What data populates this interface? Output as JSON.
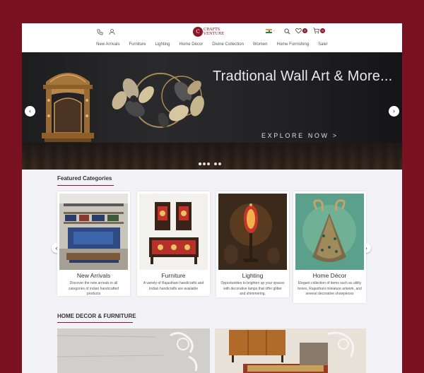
{
  "header": {
    "logo_mark": "C",
    "logo_line1": "CRAFTS",
    "logo_line2": "VENTURE",
    "cart_count": "0",
    "wishlist_count": "0",
    "icons": [
      "phone-icon",
      "user-icon",
      "india-flag-icon",
      "search-icon",
      "heart-icon",
      "cart-icon"
    ]
  },
  "nav": {
    "items": [
      "New Arrivals",
      "Furniture",
      "Lighting",
      "Home Décor",
      "Divine Collection",
      "Women",
      "Home Furnishing",
      "Sale!"
    ]
  },
  "hero": {
    "title": "Tradtional Wall Art & More...",
    "cta": "EXPLORE NOW >",
    "slide_count": 5,
    "active_slide": 1
  },
  "featured": {
    "title": "Featured Categories",
    "cards": [
      {
        "title": "New Arrivals",
        "desc": "Discover the new arrivals in all categories of indian handcrafted products"
      },
      {
        "title": "Furniture",
        "desc": "A variety of Rajasthani handicrafts and Indian handicrafts are available"
      },
      {
        "title": "Lighting",
        "desc": "Opportunities to brighten up your spaces with decorative lamps that offer glitter and shimmering."
      },
      {
        "title": "Home Décor",
        "desc": "Elegant collection of items such as utility boxes, Rajasthani miniature artwork, and several decorative showpieces"
      }
    ]
  },
  "home_decor": {
    "title": "HOME DECOR & FURNITURE"
  },
  "colors": {
    "brand": "#8a1628",
    "frame": "#7a1121",
    "background": "#f3f3f7"
  }
}
